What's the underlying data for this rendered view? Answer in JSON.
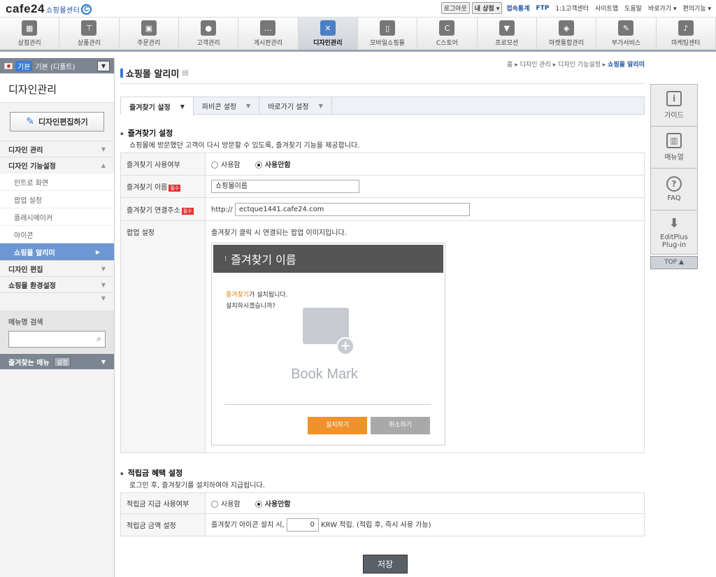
{
  "header": {
    "logo": "cafe24",
    "logo_sub": "쇼핑몰센터",
    "logo_c": "C",
    "links": [
      "로그아웃",
      "내 상점",
      "접속통계",
      "FTP",
      "1:1고객센터",
      "사이트맵",
      "도움말",
      "바로가기",
      "편의기능"
    ]
  },
  "menu": [
    {
      "label": "상점관리",
      "icon": "store-icon"
    },
    {
      "label": "상품관리",
      "icon": "shirt-icon"
    },
    {
      "label": "주문관리",
      "icon": "box-icon"
    },
    {
      "label": "고객관리",
      "icon": "person-icon"
    },
    {
      "label": "게시판관리",
      "icon": "chat-icon"
    },
    {
      "label": "디자인관리",
      "icon": "design-tools-icon"
    },
    {
      "label": "모바일쇼핑몰",
      "icon": "mobile-icon"
    },
    {
      "label": "C스토어",
      "icon": "c-store-icon"
    },
    {
      "label": "프로모션",
      "icon": "promotion-icon"
    },
    {
      "label": "마켓통합관리",
      "icon": "cube-icon"
    },
    {
      "label": "부가서비스",
      "icon": "pen-icon"
    },
    {
      "label": "마케팅센터",
      "icon": "microphone-icon"
    }
  ],
  "sidebar": {
    "skin_badge": "기본",
    "skin_name": "기본 (디폴트)",
    "title": "디자인관리",
    "edit_button": "디자인편집하기",
    "items": [
      {
        "label": "디자인 관리"
      },
      {
        "label": "디자인 기능설정"
      }
    ],
    "subitems": [
      "인트로 화면",
      "팝업 설정",
      "플래시메이커",
      "아이콘",
      "쇼핑몰 알리미"
    ],
    "items2": [
      {
        "label": "디자인 편집"
      },
      {
        "label": "쇼핑몰 환경설정"
      }
    ],
    "search_label": "메뉴명 검색",
    "fav_label": "즐겨찾는 메뉴",
    "fav_set": "설정"
  },
  "main": {
    "title": "쇼핑몰 알리미",
    "breadcrumb": [
      "홈",
      "디자인 관리",
      "디자인 기능설정"
    ],
    "breadcrumb_current": "쇼핑몰 알리미",
    "tabs": [
      "즐겨찾기 설정",
      "파비콘 설정",
      "바로가기 설정"
    ],
    "section1": {
      "title": "즐겨찾기 설정",
      "desc": "쇼핑몰에 방문했던 고객이 다시 방문할 수 있도록, 즐겨찾기 기능을 제공합니다.",
      "use_label": "즐겨찾기 사용여부",
      "opt_use": "사용함",
      "opt_nouse": "사용안함",
      "name_label": "즐겨찾기 이름",
      "name_value": "쇼핑몰이름",
      "url_label": "즐겨찾기 연결주소",
      "url_prefix": "http://",
      "url_value": "ectque1441.cafe24.com",
      "popup_label": "팝업 설정",
      "popup_desc": "즐겨찾기 클릭 시 연결되는 팝업 이미지입니다.",
      "required": "필수"
    },
    "popup": {
      "title": "즐겨찾기 이름",
      "msg_highlight": "즐겨찾기",
      "msg1_rest": "가 설치됩니다.",
      "msg2": "설치하시겠습니까?",
      "bookmark_text": "Book Mark",
      "install_btn": "설치하기",
      "cancel_btn": "취소하기"
    },
    "section2": {
      "title": "적립금 혜택 설정",
      "desc": "로그인 후, 즐겨찾기를 설치하여야 지급됩니다.",
      "use_label": "적립금 지급 사용여부",
      "opt_use": "사용함",
      "opt_nouse": "사용안함",
      "amount_label": "적립금 금액 설정",
      "amount_prefix": "즐겨찾기 아이콘 설치 시,",
      "amount_value": "0",
      "amount_suffix": "KRW 적립. (적립 후, 즉시 사용 가능)"
    },
    "save_button": "저장"
  },
  "right_panel": {
    "buttons": [
      {
        "label": "가이드",
        "icon": "guide-icon"
      },
      {
        "label": "매뉴얼",
        "icon": "manual-icon"
      },
      {
        "label": "FAQ",
        "icon": "faq-icon"
      },
      {
        "label": "EditPlus Plug-in",
        "icon": "download-icon"
      }
    ],
    "top": "TOP"
  }
}
